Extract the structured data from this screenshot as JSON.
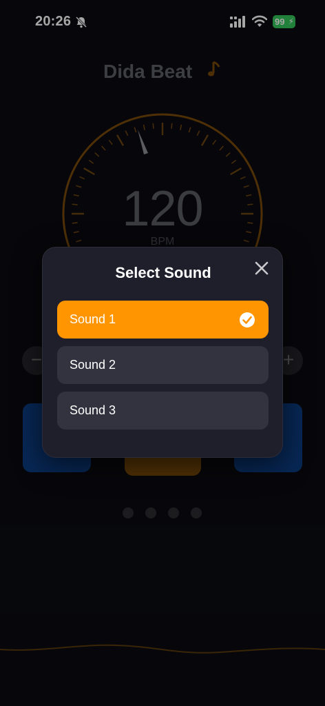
{
  "status_bar": {
    "time": "20:26",
    "battery": "99",
    "icons": [
      "bell-slash-icon",
      "signal-icon",
      "wifi-icon",
      "battery-icon"
    ]
  },
  "app": {
    "title": "Dida Beat",
    "title_icon": "music-note-icon"
  },
  "metronome": {
    "bpm": "120",
    "bpm_unit": "BPM"
  },
  "controls": {
    "decrease_label": "−",
    "increase_label": "+"
  },
  "pager": {
    "pages": 4
  },
  "modal": {
    "title": "Select Sound",
    "close_icon": "close-icon",
    "options": [
      {
        "label": "Sound 1",
        "selected": true
      },
      {
        "label": "Sound 2",
        "selected": false
      },
      {
        "label": "Sound 3",
        "selected": false
      }
    ]
  },
  "colors": {
    "accent": "#ff9500",
    "background": "#0b0c11",
    "modal_bg": "#1f1e2b",
    "option_bg": "#33333f",
    "battery": "#34c759",
    "card_blue": "#0b3d82"
  }
}
